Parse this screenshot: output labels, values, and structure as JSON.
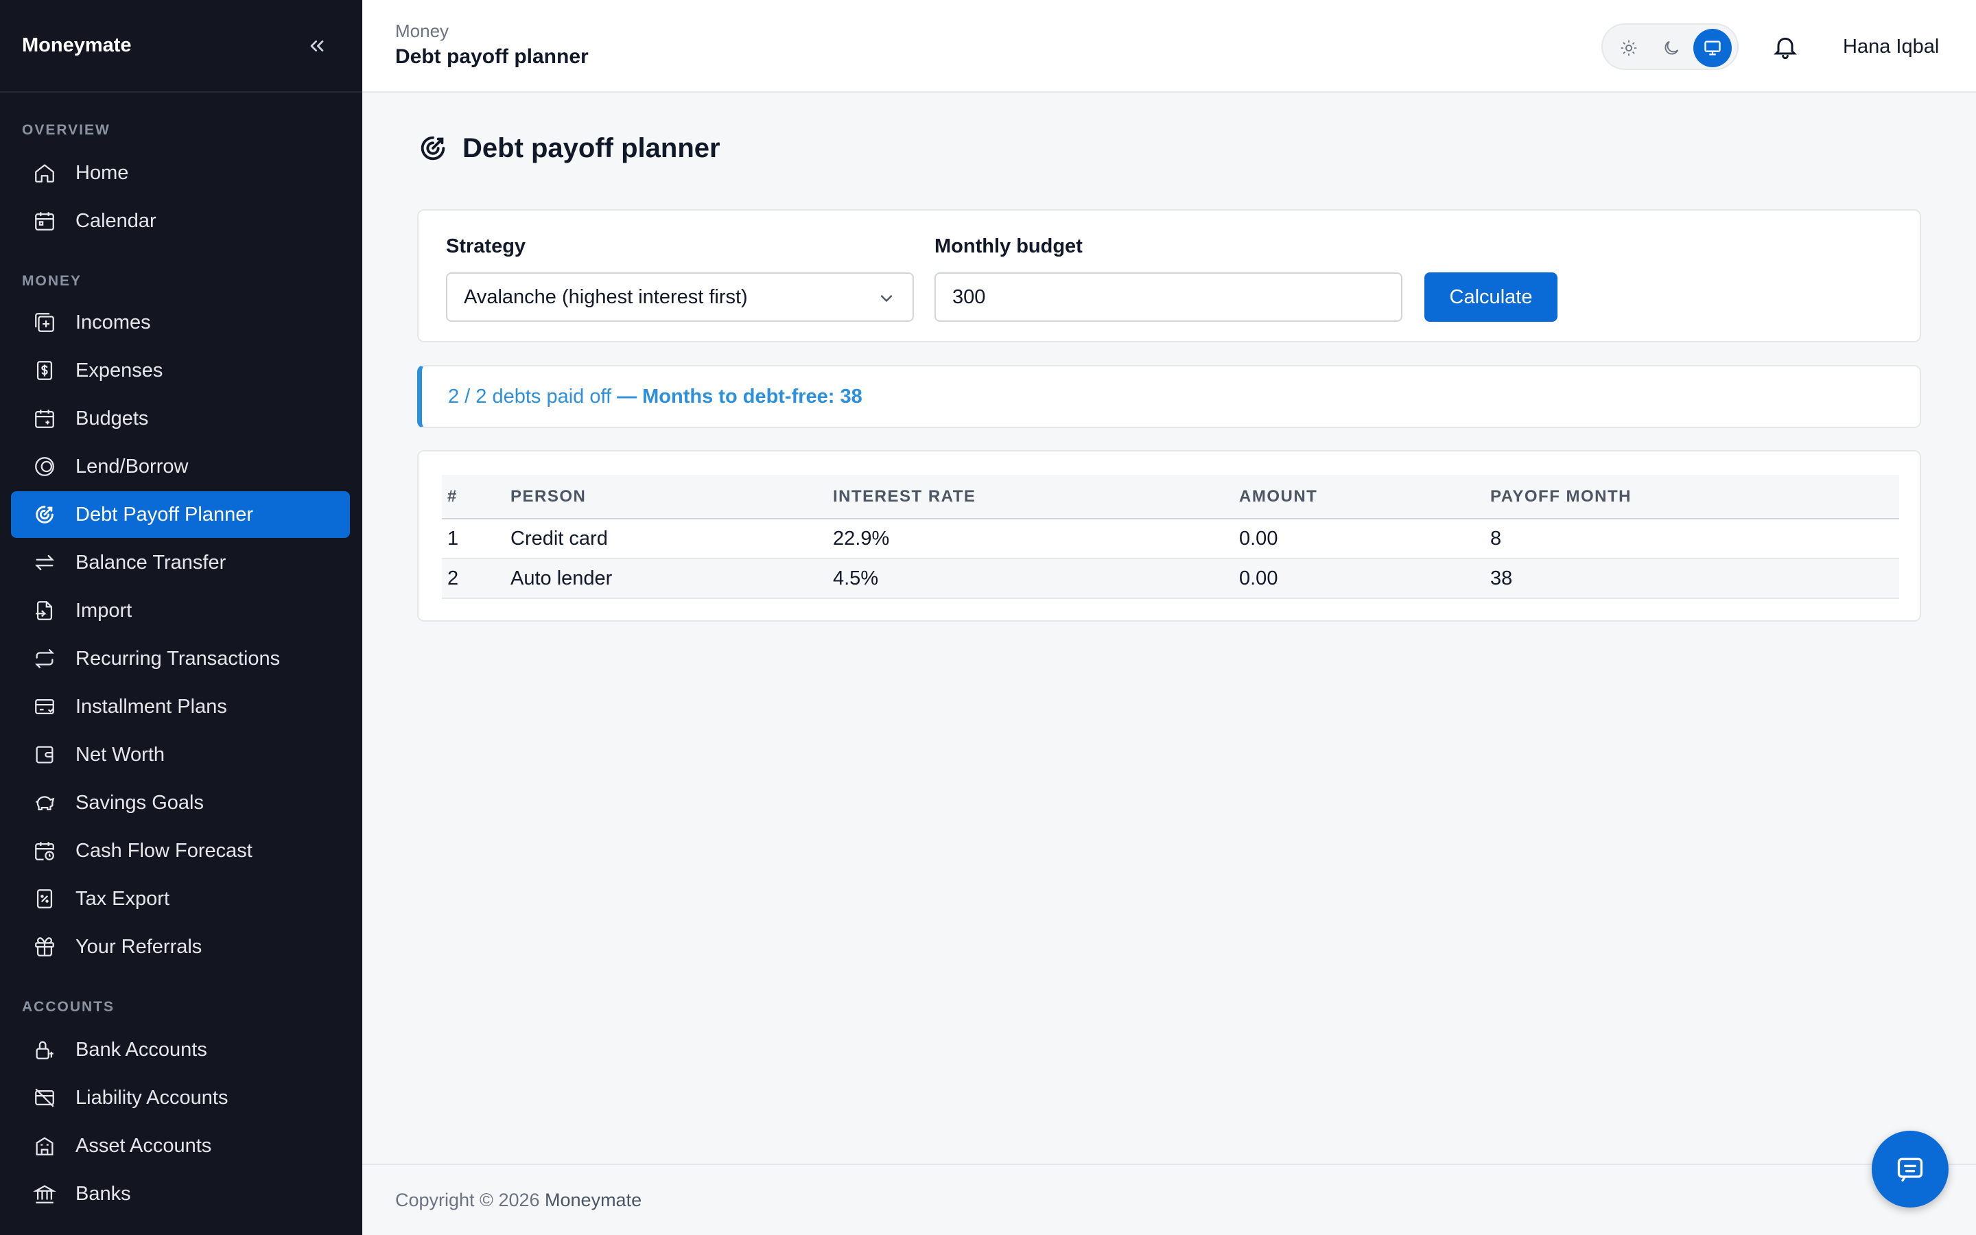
{
  "app": {
    "brand": "Moneymate"
  },
  "sidebar": {
    "sections": {
      "overview": "OVERVIEW",
      "money": "MONEY",
      "accounts": "ACCOUNTS"
    },
    "items": [
      {
        "label": "Home",
        "icon": "home-icon"
      },
      {
        "label": "Calendar",
        "icon": "calendar-icon"
      },
      {
        "label": "Incomes",
        "icon": "income-icon"
      },
      {
        "label": "Expenses",
        "icon": "dollar-icon"
      },
      {
        "label": "Budgets",
        "icon": "budget-icon"
      },
      {
        "label": "Lend/Borrow",
        "icon": "lend-icon"
      },
      {
        "label": "Debt Payoff Planner",
        "icon": "target-icon",
        "active": true
      },
      {
        "label": "Balance Transfer",
        "icon": "transfer-icon"
      },
      {
        "label": "Import",
        "icon": "import-icon"
      },
      {
        "label": "Recurring Transactions",
        "icon": "repeat-icon"
      },
      {
        "label": "Installment Plans",
        "icon": "card-icon"
      },
      {
        "label": "Net Worth",
        "icon": "wallet-icon"
      },
      {
        "label": "Savings Goals",
        "icon": "piggy-icon"
      },
      {
        "label": "Cash Flow Forecast",
        "icon": "forecast-icon"
      },
      {
        "label": "Tax Export",
        "icon": "tax-icon"
      },
      {
        "label": "Your Referrals",
        "icon": "gift-icon"
      },
      {
        "label": "Bank Accounts",
        "icon": "lock-icon"
      },
      {
        "label": "Liability Accounts",
        "icon": "liability-icon"
      },
      {
        "label": "Asset Accounts",
        "icon": "building-icon"
      },
      {
        "label": "Banks",
        "icon": "bank-icon"
      }
    ]
  },
  "header": {
    "breadcrumb_parent": "Money",
    "breadcrumb_title": "Debt payoff planner",
    "user_name": "Hana Iqbal"
  },
  "page": {
    "title": "Debt payoff planner"
  },
  "form": {
    "strategy_label": "Strategy",
    "strategy_value": "Avalanche (highest interest first)",
    "budget_label": "Monthly budget",
    "budget_value": "300",
    "calculate_label": "Calculate"
  },
  "alert": {
    "paid_text": "2 / 2 debts paid off",
    "months_text": "— Months to debt-free: 38"
  },
  "table": {
    "headers": [
      "#",
      "PERSON",
      "INTEREST RATE",
      "AMOUNT",
      "PAYOFF MONTH"
    ],
    "rows": [
      [
        "1",
        "Credit card",
        "22.9%",
        "0.00",
        "8"
      ],
      [
        "2",
        "Auto lender",
        "4.5%",
        "0.00",
        "38"
      ]
    ]
  },
  "footer": {
    "copyright": "Copyright © 2026",
    "brand": "Moneymate"
  },
  "colors": {
    "accent": "#0b6bd6",
    "sidebar_bg": "#131620",
    "info": "#2b8fdc"
  }
}
